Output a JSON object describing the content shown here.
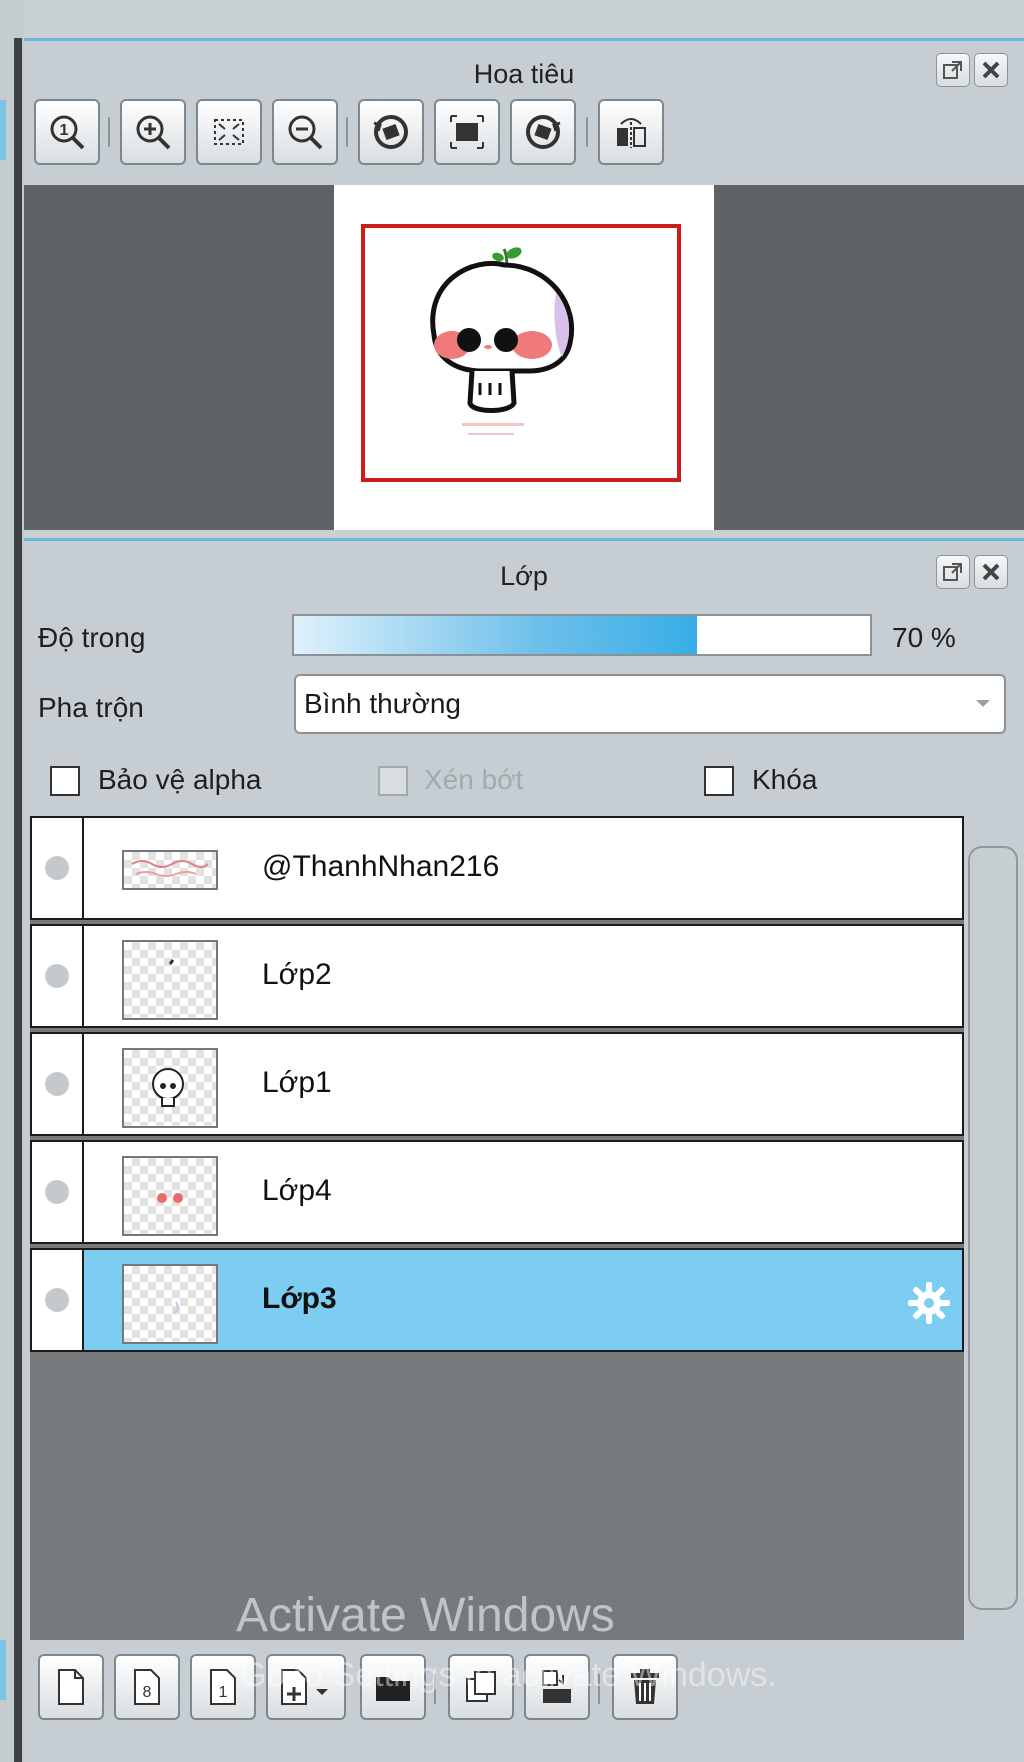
{
  "navigator": {
    "title": "Hoa tiêu",
    "toolbar": [
      {
        "name": "zoom-actual-size-icon",
        "glyph": "①"
      },
      {
        "name": "zoom-in-icon",
        "glyph": "+"
      },
      {
        "name": "fit-to-window-icon",
        "glyph": "⤢"
      },
      {
        "name": "zoom-out-icon",
        "glyph": "−"
      },
      {
        "name": "rotate-left-icon",
        "glyph": "⟲"
      },
      {
        "name": "reset-rotation-icon",
        "glyph": "▣"
      },
      {
        "name": "rotate-right-icon",
        "glyph": "⟳"
      },
      {
        "name": "flip-horizontal-icon",
        "glyph": "⇋"
      }
    ]
  },
  "layers_panel": {
    "title": "Lớp",
    "opacity_label": "Độ trong",
    "opacity_value": "70 %",
    "opacity_fraction": 0.7,
    "blend_label": "Pha trộn",
    "blend_value": "Bình thường",
    "protect_alpha_label": "Bảo vệ alpha",
    "clipping_label": "Xén bớt",
    "lock_label": "Khóa",
    "layers": [
      {
        "name": "@ThanhNhan216",
        "selected": false
      },
      {
        "name": "Lớp2",
        "selected": false
      },
      {
        "name": "Lớp1",
        "selected": false
      },
      {
        "name": "Lớp4",
        "selected": false
      },
      {
        "name": "Lớp3",
        "selected": true
      }
    ],
    "bottom_toolbar": [
      {
        "name": "new-layer-icon"
      },
      {
        "name": "new-8bit-layer-icon"
      },
      {
        "name": "new-1bit-layer-icon"
      },
      {
        "name": "add-layer-dropdown-icon"
      },
      {
        "name": "new-folder-icon"
      },
      {
        "name": "copy-layer-icon"
      },
      {
        "name": "merge-down-icon"
      },
      {
        "name": "delete-layer-icon"
      }
    ]
  },
  "watermark": {
    "line1": "Activate Windows",
    "line2": "Go to Settings to activate Windows."
  },
  "colors": {
    "accent": "#6ab7e0",
    "selection": "#7dcdf2",
    "frame": "#cc1c1c"
  }
}
